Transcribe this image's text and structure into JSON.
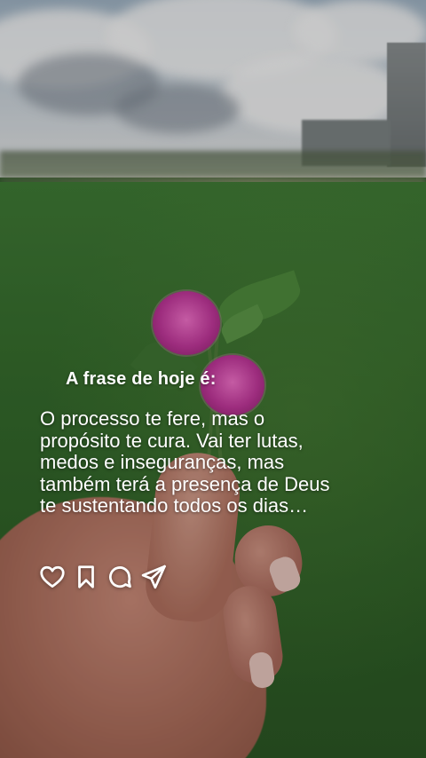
{
  "post": {
    "title": "A frase de hoje é:",
    "quote_lines": [
      "O processo te fere, mas o",
      "propósito te cura. Vai ter lutas,",
      "medos e inseguranças, mas",
      "também terá a presença de Deus",
      "te sustentando todos os dias…"
    ]
  },
  "actions": {
    "like_icon": "heart-icon",
    "save_icon": "bookmark-icon",
    "comment_icon": "comment-icon",
    "share_icon": "send-icon"
  },
  "colors": {
    "text": "#ffffff",
    "flower": "#c0379a",
    "grass": "#356b2c"
  }
}
